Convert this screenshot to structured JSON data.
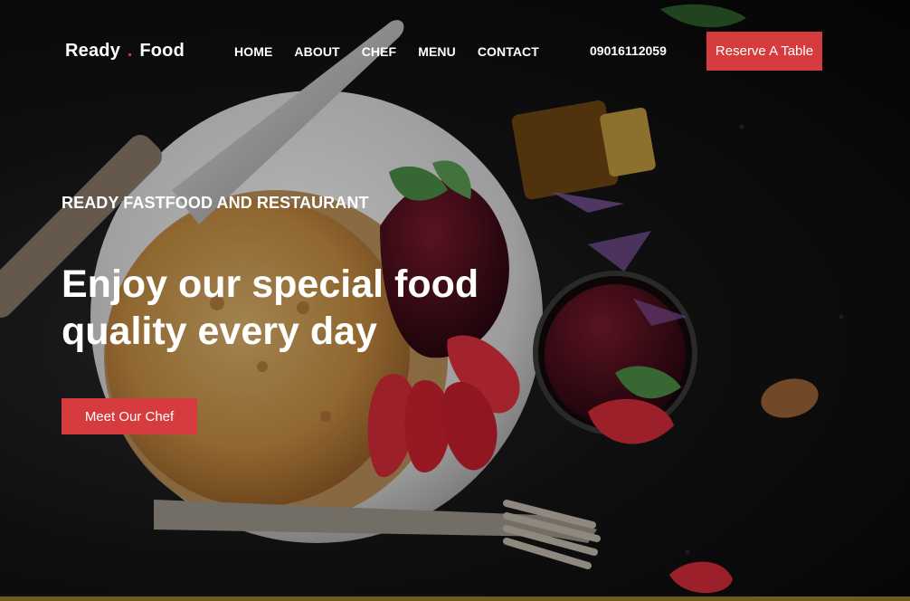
{
  "brand": {
    "first": "Ready",
    "dot": ".",
    "second": "Food"
  },
  "nav": {
    "items": [
      {
        "label": "HOME"
      },
      {
        "label": "ABOUT"
      },
      {
        "label": "CHEF"
      },
      {
        "label": "MENU"
      },
      {
        "label": "CONTACT"
      }
    ],
    "phone": "09016112059",
    "reserve_label": "Reserve A Table"
  },
  "hero": {
    "eyebrow": "READY FASTFOOD AND RESTAURANT",
    "headline": "Enjoy our special food quality every day",
    "chef_button": "Meet Our Chef",
    "background_image": "pancakes-with-strawberries-jam-and-cutlery"
  },
  "colors": {
    "accent": "#d63b3e",
    "text": "#ffffff",
    "background": "#0f0f0f"
  }
}
